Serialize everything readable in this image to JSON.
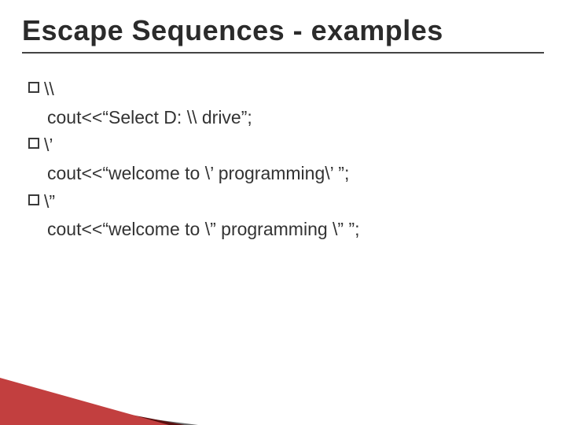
{
  "title": "Escape Sequences - examples",
  "items": [
    {
      "bullet": "\\\\",
      "line": "cout<<“Select D: \\\\ drive”;"
    },
    {
      "bullet": "\\’",
      "line": "cout<<“welcome to \\’ programming\\’ ”;"
    },
    {
      "bullet": "\\”",
      "line": "cout<<“welcome to \\” programming \\” ”;"
    }
  ],
  "colors": {
    "accent1": "#6a6a6a",
    "accent2": "#5a0f0f",
    "accent3": "#c23f3f"
  }
}
